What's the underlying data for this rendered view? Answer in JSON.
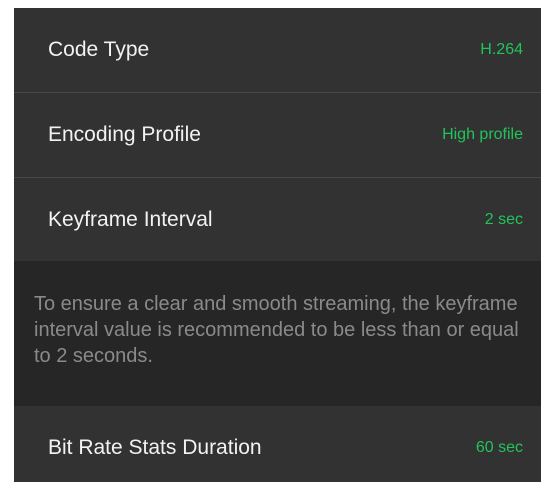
{
  "settings": {
    "rows": [
      {
        "label": "Code Type",
        "value": "H.264"
      },
      {
        "label": "Encoding Profile",
        "value": "High profile"
      },
      {
        "label": "Keyframe Interval",
        "value": "2 sec"
      },
      {
        "label": "Bit Rate Stats Duration",
        "value": "60 sec"
      }
    ],
    "keyframe_hint": "To ensure a clear and smooth streaming, the keyframe interval value is recommended to be less than or equal to 2 seconds."
  },
  "colors": {
    "value_green": "#22c35a",
    "row_background": "#323232",
    "hint_background": "#262626",
    "label_text": "#f2f2f2",
    "hint_text": "#8a8a8a"
  }
}
